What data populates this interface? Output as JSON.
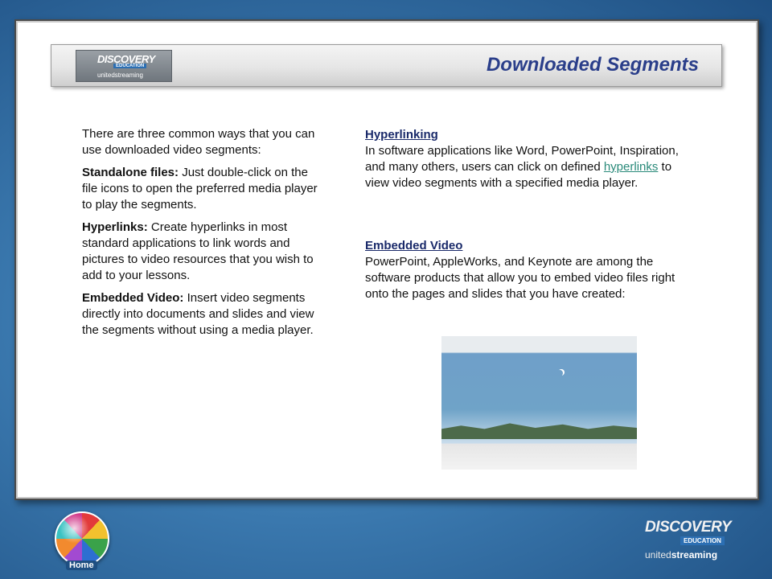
{
  "header": {
    "title": "Downloaded Segments",
    "logo": {
      "line1": "DISCOVERY",
      "line2": "EDUCATION",
      "line3": "unitedstreaming"
    }
  },
  "left": {
    "intro": "There are three common ways that you can use downloaded video segments:",
    "items": [
      {
        "term": "Standalone files:",
        "desc": " Just double-click on the file icons to open the preferred media player to play the segments."
      },
      {
        "term": "Hyperlinks:",
        "desc": " Create hyperlinks in most standard applications to link words and pictures to video resources that you wish to add to your lessons."
      },
      {
        "term": "Embedded Video:",
        "desc": " Insert video segments directly into documents and slides and view the segments without using a media player."
      }
    ]
  },
  "right": {
    "hyperlinking": {
      "title": "Hyperlinking",
      "text_before": "In software applications like Word, PowerPoint, Inspiration, and many others, users can click on defined ",
      "link": "hyperlinks",
      "text_after": " to view video segments with a specified media player."
    },
    "embedded": {
      "title": "Embedded Video",
      "text": "PowerPoint, AppleWorks, and Keynote are among the software products that allow you to embed video files right onto the pages and slides that you have created:"
    }
  },
  "footer": {
    "home_label": "Home",
    "logo": {
      "line1": "DISCOVERY",
      "line2": "EDUCATION",
      "line3a": "united",
      "line3b": "streaming"
    }
  }
}
